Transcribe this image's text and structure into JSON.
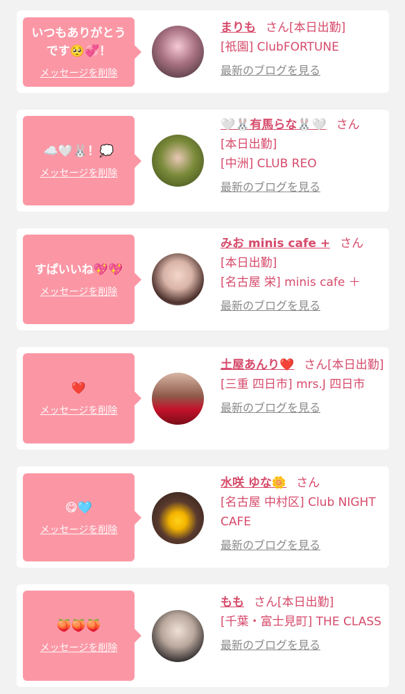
{
  "common": {
    "delete_label": "メッセージを削除",
    "blog_label": "最新のブログを見る",
    "san": "さん"
  },
  "colors": {
    "bubble": "#fb97a5",
    "accent": "#d64a6a",
    "muted": "#8a8a8a",
    "background": "#f2f2f2"
  },
  "cards": [
    {
      "message": "いつもありがとうです🥺💞！",
      "name": "まりも",
      "info_line1": "[本日出勤]",
      "info_line2": "[祇園] ClubFORTUNE",
      "avatar_icon": "avatar-photo"
    },
    {
      "message": "☁️🤍🐰！💭",
      "name": "🤍🐰有馬らな🐰🤍",
      "info_line1": "[本日出勤]",
      "info_line2": "[中洲] CLUB REO",
      "avatar_icon": "avatar-photo"
    },
    {
      "message": "すぱいいね💖💖",
      "name": "みお minis cafe +",
      "info_line1": "[本日出勤]",
      "info_line2": "[名古屋 栄] minis cafe ＋",
      "avatar_icon": "avatar-photo"
    },
    {
      "message": "❤️",
      "name": "土屋あんり❤️",
      "info_line1": "[本日出勤]",
      "info_line2": "[三重 四日市] mrs.J 四日市",
      "avatar_icon": "avatar-photo"
    },
    {
      "message": "😋🩵",
      "name": "水咲 ゆな🌼",
      "info_line1": "[名古屋 中村区] Club NIGHT CAFE",
      "info_line2": "",
      "avatar_icon": "avatar-photo"
    },
    {
      "message": "🍑🍑🍑",
      "name": "もも",
      "info_line1": "[本日出勤]",
      "info_line2": "[千葉・富士見町] THE CLASS",
      "avatar_icon": "avatar-photo"
    }
  ]
}
